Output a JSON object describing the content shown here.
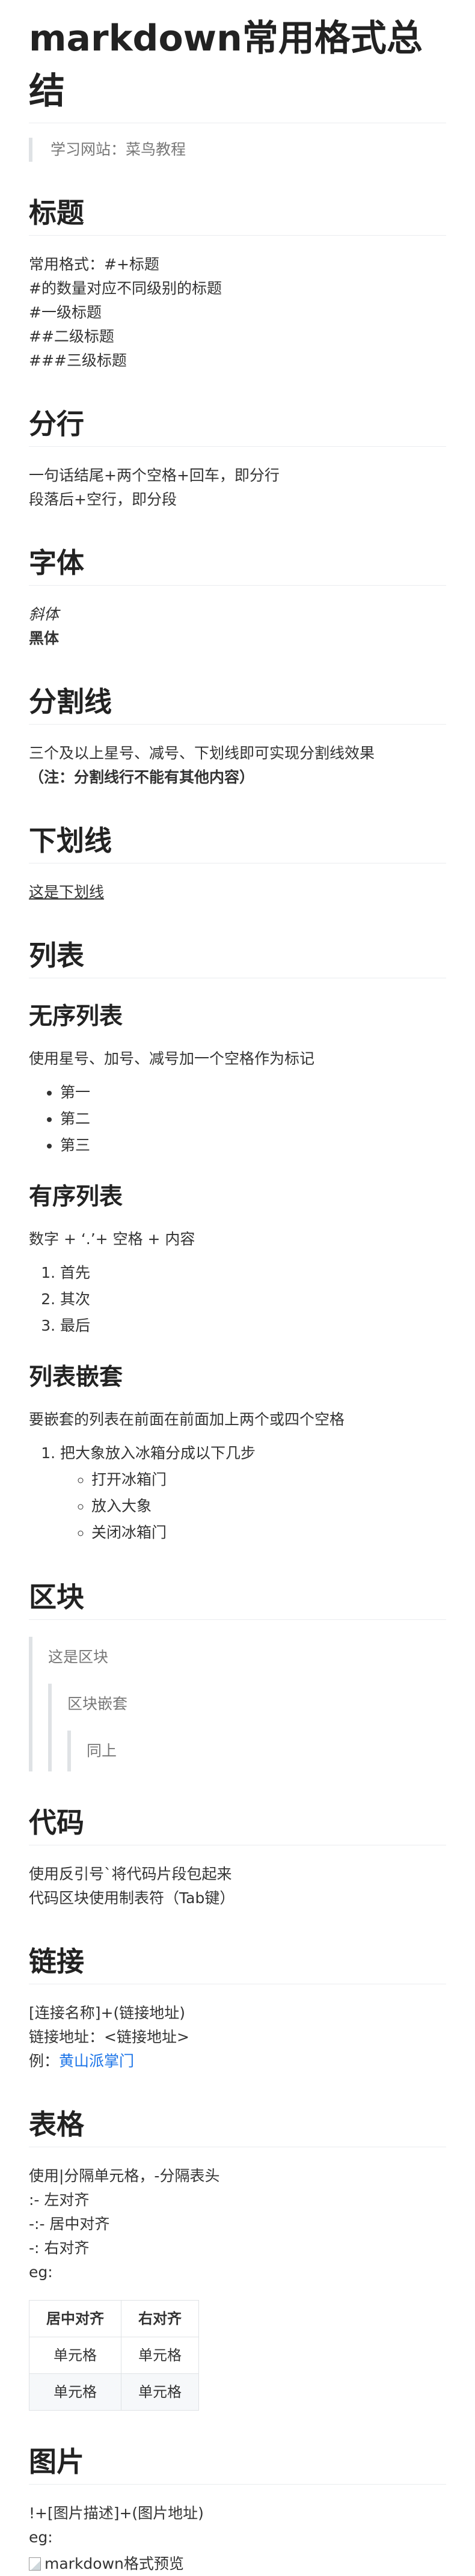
{
  "title": "markdown常用格式总结",
  "intro": "学习网站：菜鸟教程",
  "heading": {
    "title": "标题",
    "lines": [
      "常用格式：#+标题",
      "#的数量对应不同级别的标题",
      "#一级标题",
      "##二级标题",
      "###三级标题"
    ]
  },
  "linebreak": {
    "title": "分行",
    "lines": [
      "一句话结尾+两个空格+回车，即分行",
      "段落后+空行，即分段"
    ]
  },
  "font": {
    "title": "字体",
    "italic": "斜体",
    "bold": "黑体"
  },
  "divider": {
    "title": "分割线",
    "line1": "三个及以上星号、减号、下划线即可实现分割线效果",
    "note": "（注：分割线行不能有其他内容）"
  },
  "underline": {
    "title": "下划线",
    "text": "这是下划线"
  },
  "list": {
    "title": "列表",
    "unordered": {
      "title": "无序列表",
      "desc": "使用星号、加号、减号加一个空格作为标记",
      "items": [
        "第一",
        "第二",
        "第三"
      ]
    },
    "ordered": {
      "title": "有序列表",
      "desc": "数字 + ‘.’+ 空格 + 内容",
      "items": [
        "首先",
        "其次",
        "最后"
      ]
    },
    "nested": {
      "title": "列表嵌套",
      "desc": "要嵌套的列表在前面在前面加上两个或四个空格",
      "item": "把大象放入冰箱分成以下几步",
      "subitems": [
        "打开冰箱门",
        "放入大象",
        "关闭冰箱门"
      ]
    }
  },
  "blocks": {
    "title": "区块",
    "level1": "这是区块",
    "level2": "区块嵌套",
    "level3": "同上"
  },
  "code": {
    "title": "代码",
    "lines": [
      "使用反引号`将代码片段包起来",
      "代码区块使用制表符（Tab键）"
    ]
  },
  "links": {
    "title": "链接",
    "line1": "[连接名称]+(链接地址)",
    "line2": "链接地址：<链接地址>",
    "example_prefix": "例：",
    "example_link": "黄山派掌门"
  },
  "table": {
    "title": "表格",
    "lines": [
      "使用|分隔单元格，-分隔表头",
      ":- 左对齐",
      "-:- 居中对齐",
      "-: 右对齐",
      "eg:"
    ],
    "headers": [
      "居中对齐",
      "右对齐"
    ],
    "rows": [
      [
        "单元格",
        "单元格"
      ],
      [
        "单元格",
        "单元格"
      ]
    ]
  },
  "image": {
    "title": "图片",
    "line1": "!+[图片描述]+(图片地址)",
    "line2": "eg:",
    "alt": "markdown格式预览"
  }
}
